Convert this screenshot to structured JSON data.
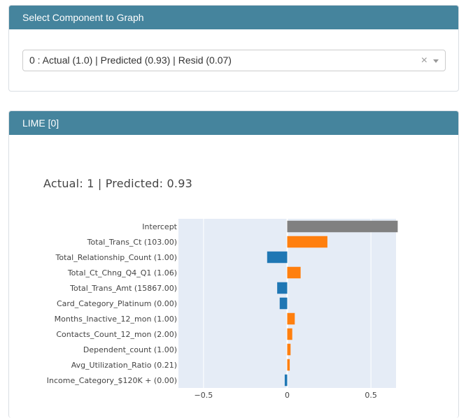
{
  "select_card": {
    "header": "Select Component to Graph",
    "selected_value": "0 : Actual (1.0) | Predicted (0.93) | Resid (0.07)",
    "clear_glyph": "×"
  },
  "lime_card": {
    "header": "LIME [0]",
    "chart_title": "Actual: 1 | Predicted: 0.93"
  },
  "colors": {
    "header_bg": "#45849d",
    "positive": "#ff7f0e",
    "negative": "#1f77b4",
    "intercept": "#808080",
    "plot_bg": "#e5ecf6"
  },
  "chart_data": {
    "type": "bar",
    "orientation": "horizontal",
    "title": "Actual: 1 | Predicted: 0.93",
    "categories": [
      "Intercept",
      "Total_Trans_Ct (103.00)",
      "Total_Relationship_Count (1.00)",
      "Total_Ct_Chng_Q4_Q1 (1.06)",
      "Total_Trans_Amt (15867.00)",
      "Card_Category_Platinum (0.00)",
      "Months_Inactive_12_mon (1.00)",
      "Contacts_Count_12_mon (2.00)",
      "Dependent_count (1.00)",
      "Avg_Utilization_Ratio (0.21)",
      "Income_Category_$120K + (0.00)"
    ],
    "values": [
      0.66,
      0.24,
      -0.12,
      0.08,
      -0.06,
      -0.045,
      0.045,
      0.03,
      0.02,
      0.015,
      -0.015
    ],
    "bar_colors": [
      "intercept",
      "positive",
      "negative",
      "positive",
      "negative",
      "negative",
      "positive",
      "positive",
      "positive",
      "positive",
      "negative"
    ],
    "xlim": [
      -0.65,
      0.65
    ],
    "xticks": [
      -0.5,
      0,
      0.5
    ],
    "xtick_labels": [
      "−0.5",
      "0",
      "0.5"
    ],
    "grid": true
  }
}
